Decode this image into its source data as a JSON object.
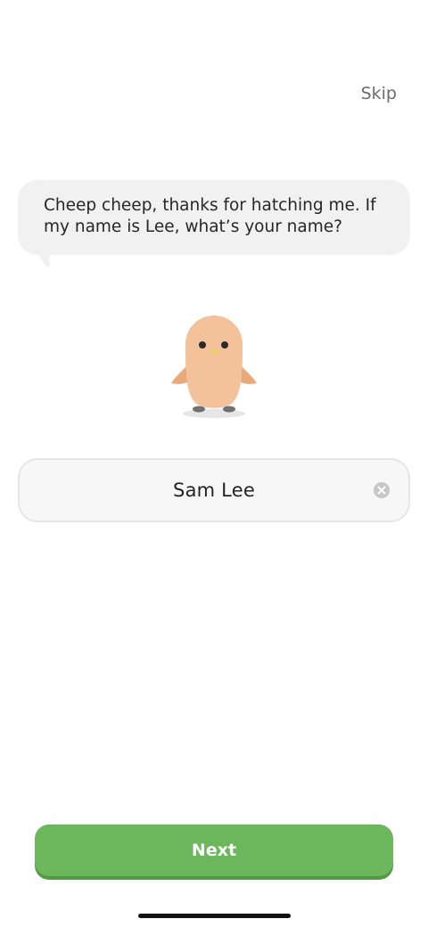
{
  "header": {
    "skip_label": "Skip"
  },
  "dialog": {
    "message": "Cheep cheep, thanks for hatching me. If my name is Lee, what’s your name?"
  },
  "mascot": {
    "icon": "chick-mascot-icon"
  },
  "name_input": {
    "value": "Sam Lee",
    "clear_icon": "clear-circle-icon"
  },
  "footer": {
    "next_label": "Next"
  },
  "colors": {
    "accent": "#6cb65c",
    "accent_shadow": "#4f9a43",
    "bubble": "#f1f1f1",
    "chick_body": "#f4c29a"
  }
}
